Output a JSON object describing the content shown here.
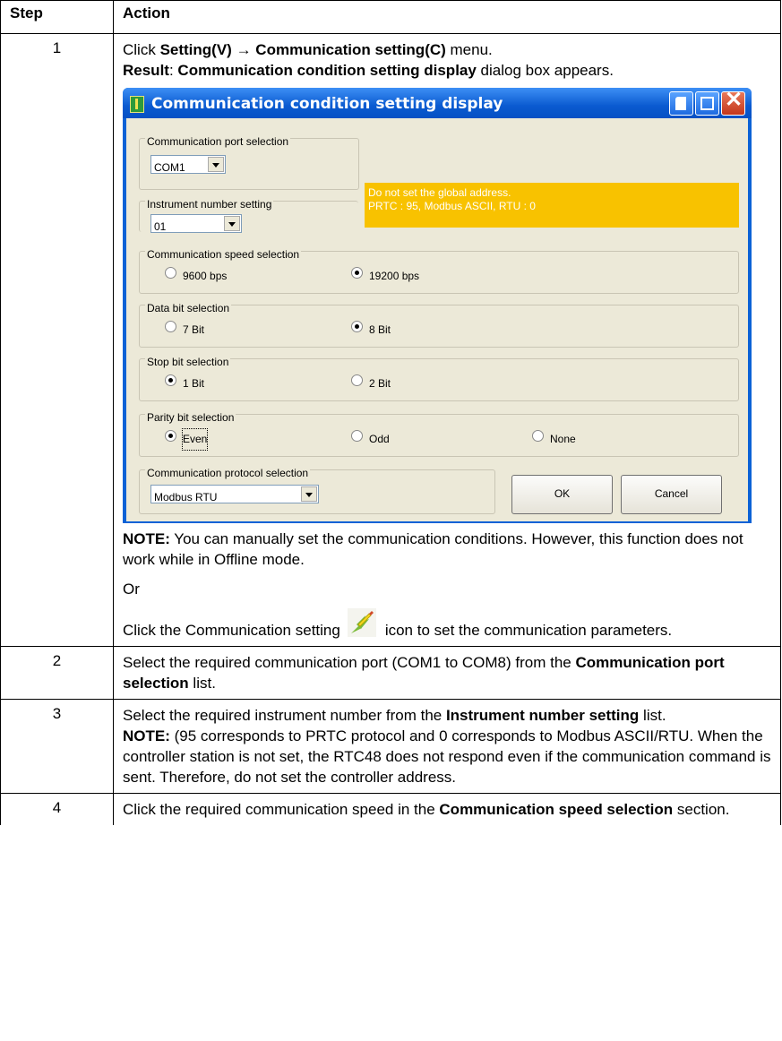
{
  "headers": {
    "step": "Step",
    "action": "Action"
  },
  "row1": {
    "step": "1",
    "click_pre": "Click ",
    "menu_setting": "Setting(V)",
    "arrow": " → ",
    "menu_comm": "Communication setting(C)",
    "menu_post": " menu.",
    "result_label": "Result",
    "result_colon": ": ",
    "result_dialog": "Communication condition setting display",
    "result_post": " dialog box appears.",
    "note_label": "NOTE:",
    "note_text": " You can manually set the communication conditions. However, this function does not work while in Offline mode.",
    "or_text": "Or",
    "icon_pre": "Click the Communication setting",
    "icon_post": "icon to set the communication parameters."
  },
  "dialog": {
    "title": "Communication condition setting display",
    "port_group": "Communication port selection",
    "port_value": "COM1",
    "instrument_group": "Instrument number setting",
    "instrument_value": "01",
    "warning_line1": "Do not set the global address.",
    "warning_line2": "PRTC : 95,  Modbus ASCII, RTU : 0",
    "speed_group": "Communication speed selection",
    "speed_opt1": "9600 bps",
    "speed_opt2": "19200 bps",
    "databit_group": "Data bit selection",
    "databit_opt1": "7 Bit",
    "databit_opt2": "8 Bit",
    "stopbit_group": "Stop bit selection",
    "stopbit_opt1": "1 Bit",
    "stopbit_opt2": "2 Bit",
    "parity_group": "Parity bit selection",
    "parity_opt1": "Even",
    "parity_opt2": "Odd",
    "parity_opt3": "None",
    "protocol_group": "Communication protocol selection",
    "protocol_value": "Modbus RTU",
    "ok_label": "OK",
    "cancel_label": "Cancel"
  },
  "row2": {
    "step": "2",
    "text_pre": "Select the required communication port (COM1 to COM8) from the ",
    "text_bold": "Communication port selection",
    "text_post": " list."
  },
  "row3": {
    "step": "3",
    "text_pre": "Select the required instrument number from the ",
    "text_bold": "Instrument number setting",
    "text_post": " list.",
    "note_label": "NOTE:",
    "note_text": " (95 corresponds to PRTC protocol and 0 corresponds to Modbus ASCII/RTU. When the controller station is not set, the RTC48 does not respond even if the communication command is sent. Therefore, do not set the controller address."
  },
  "row4": {
    "step": "4",
    "text_pre": "Click the required communication speed in the ",
    "text_bold": "Communication speed selection",
    "text_post": " section."
  },
  "colors": {
    "warning": "#f8c200",
    "titlebar": "#0a5ad0",
    "dialog_bg": "#ece9d8"
  },
  "icons": {
    "comm_setting": "lightning-pencil-icon"
  }
}
